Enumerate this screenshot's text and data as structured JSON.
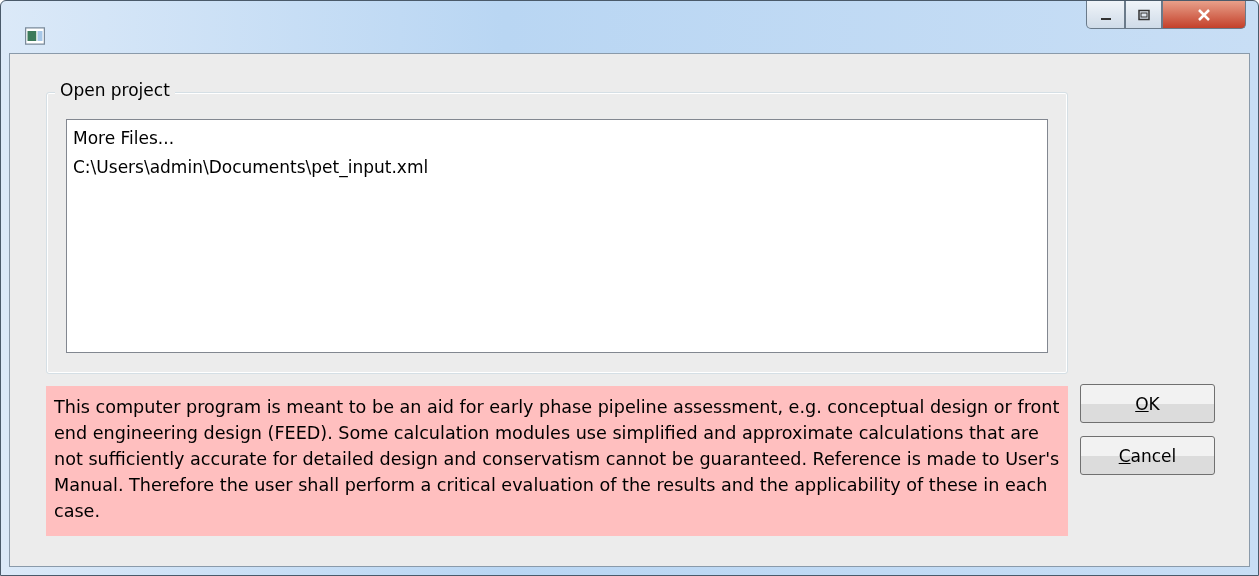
{
  "open_project": {
    "title": "Open project",
    "files": [
      {
        "label": "More Files...",
        "selected": false
      },
      {
        "label": "C:\\Users\\admin\\Documents\\pet_input.xml",
        "selected": false
      }
    ]
  },
  "disclaimer": "This computer program is meant to be an aid for early phase pipeline assessment, e.g. conceptual design or front end engineering design (FEED). Some calculation modules use simplified and approximate calculations that are not sufficiently accurate for detailed design and conservatism cannot be guaranteed. Reference is made to User's Manual. Therefore the user shall perform a critical evaluation of the results and the applicability of these in each case.",
  "buttons": [
    {
      "label": "OK",
      "underline_first": true
    },
    {
      "label": "Cancel",
      "underline_first": true
    }
  ]
}
